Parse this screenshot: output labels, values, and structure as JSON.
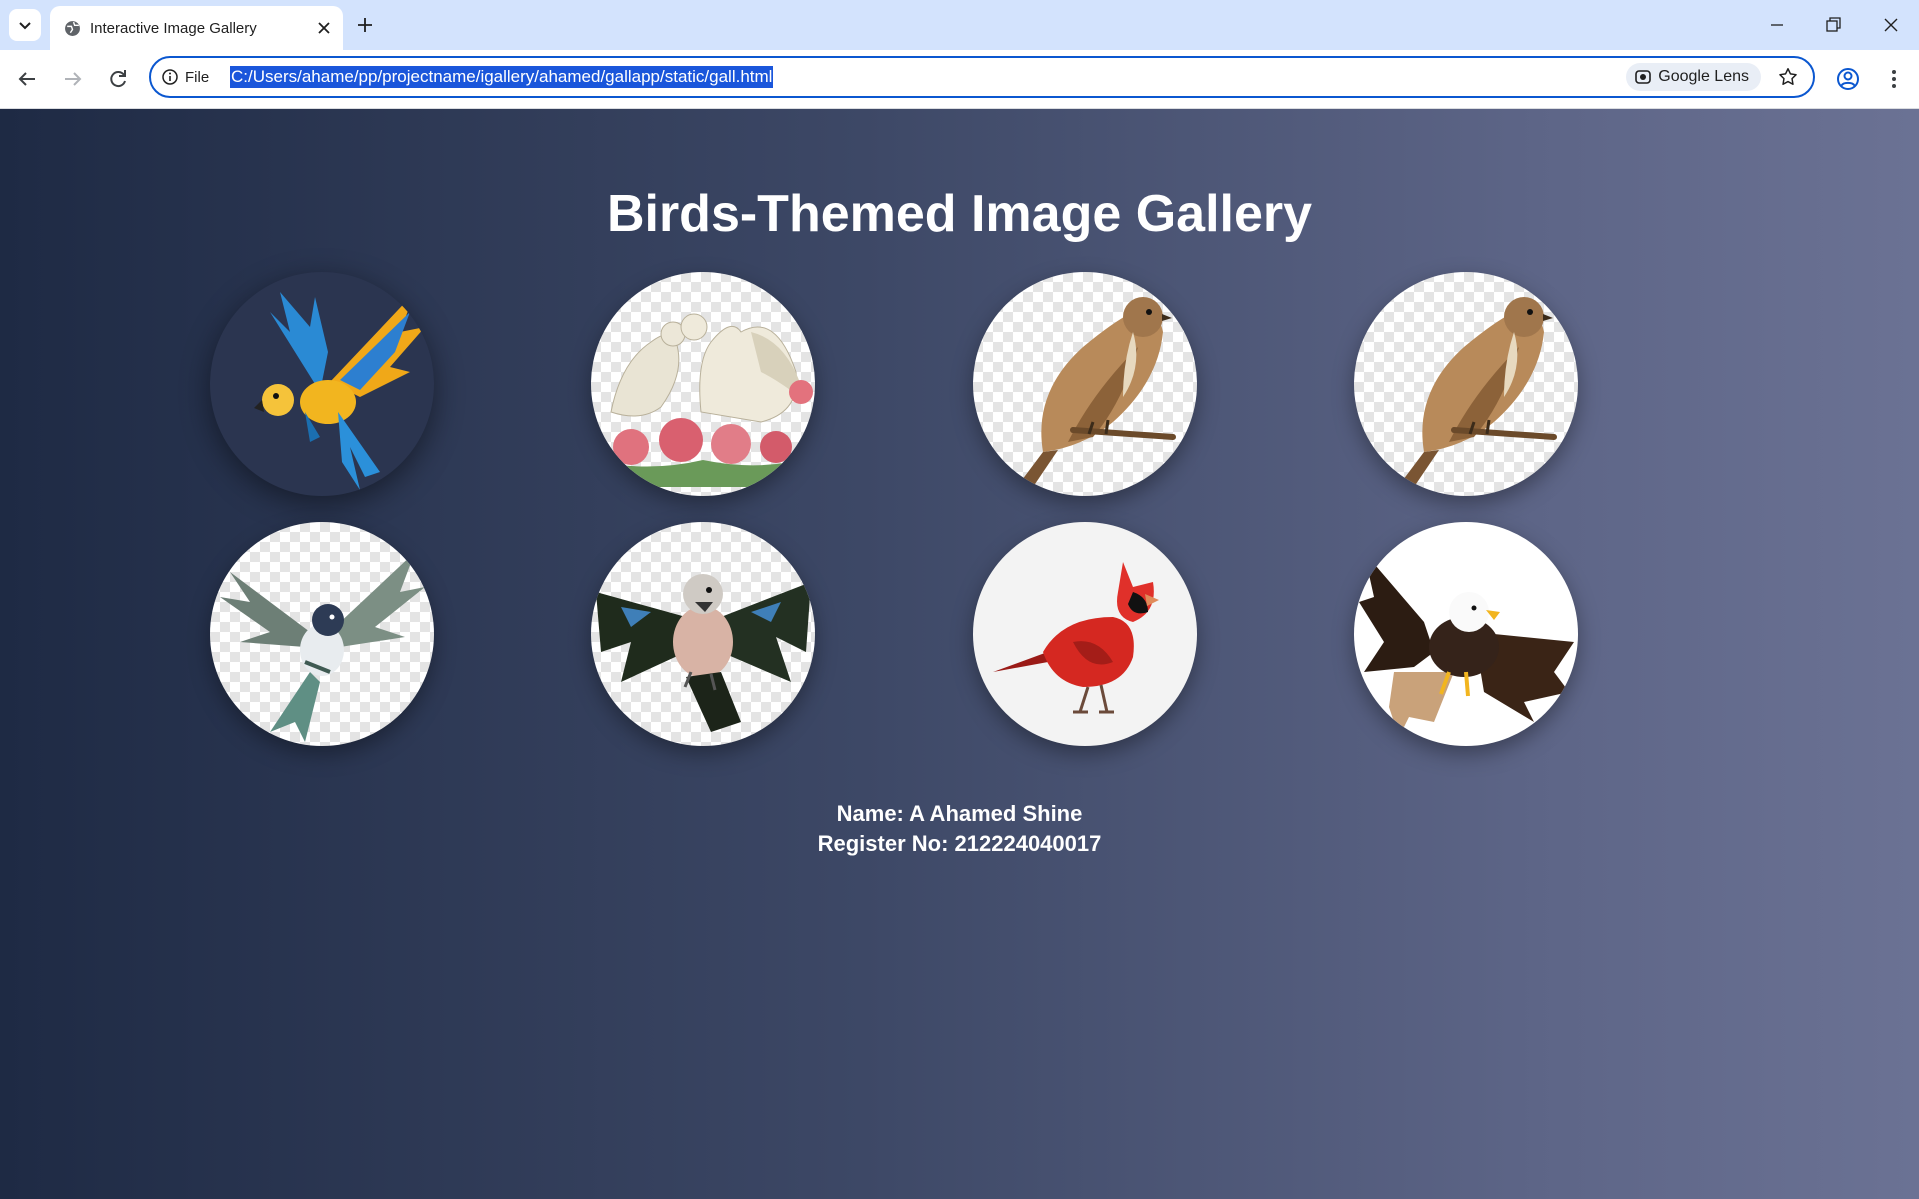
{
  "browser": {
    "tab": {
      "title": "Interactive Image Gallery"
    },
    "omnibox": {
      "site_info_label": "File",
      "url": "C:/Users/ahame/pp/projectname/igallery/ahamed/gallapp/static/gall.html",
      "lens_label": "Google Lens"
    }
  },
  "page": {
    "title": "Birds-Themed Image Gallery",
    "gallery": [
      {
        "name": "macaw"
      },
      {
        "name": "doves-with-roses"
      },
      {
        "name": "sparrow"
      },
      {
        "name": "sparrow"
      },
      {
        "name": "swallow"
      },
      {
        "name": "jay"
      },
      {
        "name": "cardinal"
      },
      {
        "name": "bald-eagle"
      }
    ],
    "footer": {
      "name_line": "Name: A Ahamed Shine",
      "register_line": "Register No: 212224040017"
    }
  }
}
